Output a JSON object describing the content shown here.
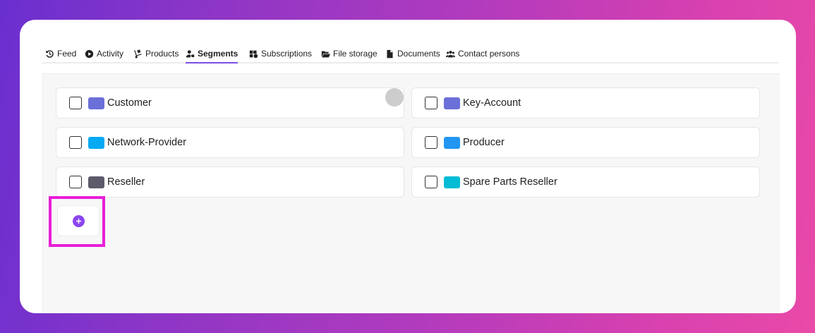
{
  "tabs": [
    {
      "label": "Feed",
      "icon": "history-icon"
    },
    {
      "label": "Activity",
      "icon": "play-circle-icon"
    },
    {
      "label": "Products",
      "icon": "dolly-icon"
    },
    {
      "label": "Segments",
      "icon": "user-tag-icon",
      "active": true
    },
    {
      "label": "Subscriptions",
      "icon": "boxes-icon"
    },
    {
      "label": "File storage",
      "icon": "folder-open-icon"
    },
    {
      "label": "Documents",
      "icon": "file-icon"
    },
    {
      "label": "Contact persons",
      "icon": "users-icon"
    }
  ],
  "segments": [
    {
      "label": "Customer",
      "color": "#6b6fd8",
      "checked": false
    },
    {
      "label": "Key-Account",
      "color": "#6b6fd8",
      "checked": false
    },
    {
      "label": "Network-Provider",
      "color": "#06a9f2",
      "checked": false
    },
    {
      "label": "Producer",
      "color": "#2196f3",
      "checked": false
    },
    {
      "label": "Reseller",
      "color": "#5d5b6a",
      "checked": false
    },
    {
      "label": "Spare Parts Reseller",
      "color": "#00bcd4",
      "checked": false
    }
  ],
  "add_button": {
    "icon": "plus-circle-icon",
    "accent": "#8b45f0",
    "highlight_color": "#e81ed8"
  }
}
